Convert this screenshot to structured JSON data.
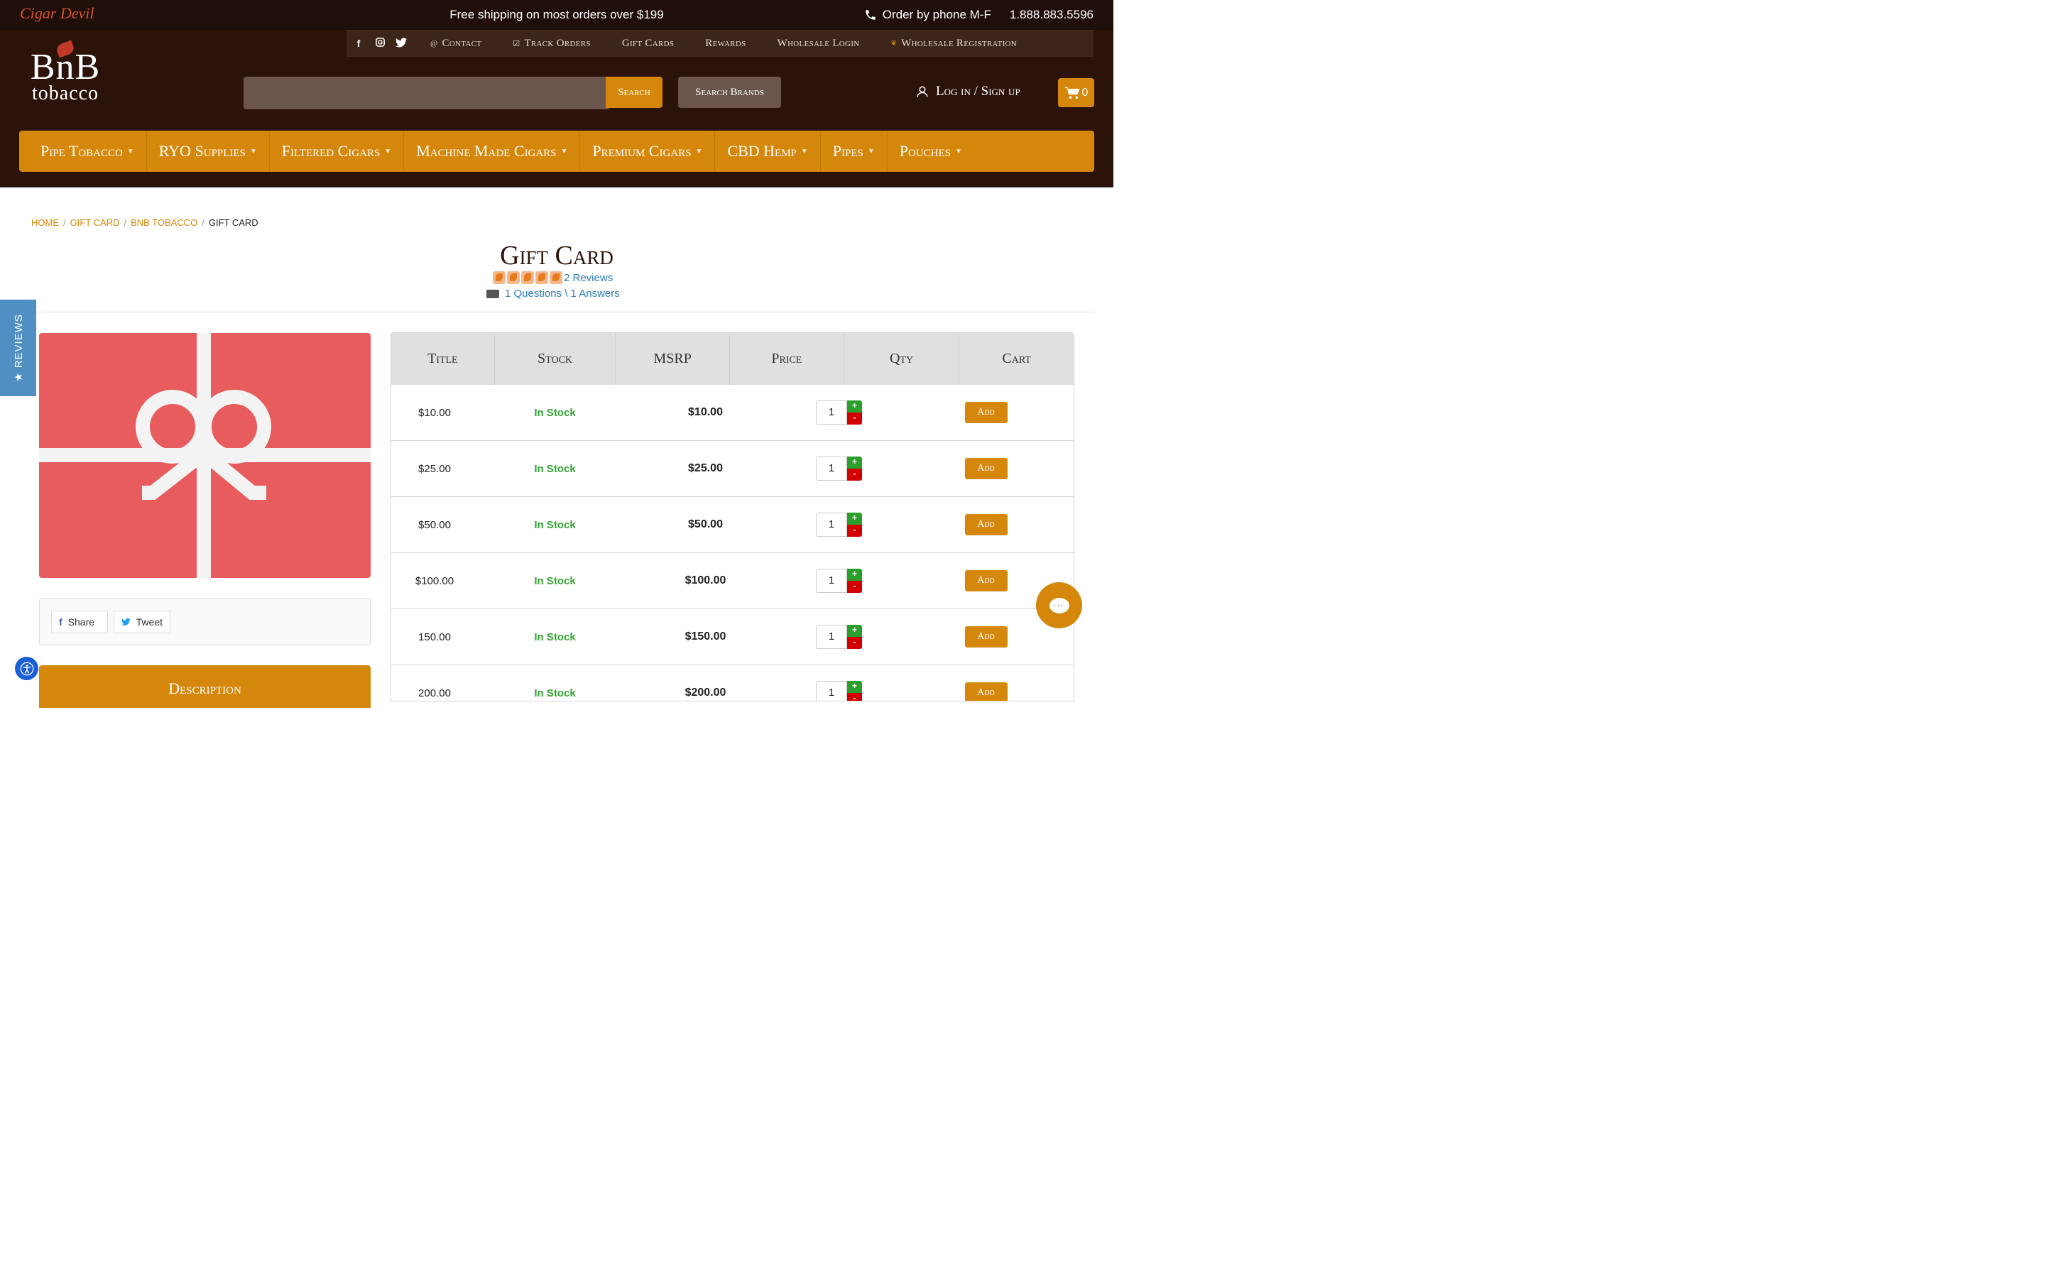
{
  "topbar": {
    "brand": "Cigar Devil",
    "shipping": "Free shipping on most orders over $199",
    "phone_label": "Order by phone M-F",
    "phone_number": "1.888.883.5596"
  },
  "utility_links": [
    "Contact",
    "Track Orders",
    "Gift Cards",
    "Rewards",
    "Wholesale Login",
    "Wholesale Registration"
  ],
  "logo": {
    "line1": "BnB",
    "line2": "tobacco"
  },
  "search": {
    "button": "Search",
    "brands_button": "Search Brands",
    "placeholder": ""
  },
  "account": {
    "login": "Log in / Sign up",
    "cart_count": "0"
  },
  "nav": [
    "Pipe Tobacco",
    "RYO Supplies",
    "Filtered Cigars",
    "Machine Made Cigars",
    "Premium Cigars",
    "CBD Hemp",
    "Pipes",
    "Pouches"
  ],
  "breadcrumb": [
    "HOME",
    "GIFT CARD",
    "BNB TOBACCO",
    "GIFT CARD"
  ],
  "product": {
    "title": "Gift Card",
    "reviews": "2 Reviews",
    "questions": "1 Questions \\ 1 Answers",
    "rating": 5
  },
  "reviews_tab": "★ REVIEWS",
  "share": {
    "share_label": "Share",
    "tweet_label": "Tweet"
  },
  "description_label": "Description",
  "table": {
    "headers": [
      "Title",
      "Stock",
      "MSRP",
      "Price",
      "Qty",
      "Cart"
    ],
    "rows": [
      {
        "title": "$10.00",
        "stock": "In Stock",
        "price": "$10.00",
        "qty": "1",
        "cart": "Add"
      },
      {
        "title": "$25.00",
        "stock": "In Stock",
        "price": "$25.00",
        "qty": "1",
        "cart": "Add"
      },
      {
        "title": "$50.00",
        "stock": "In Stock",
        "price": "$50.00",
        "qty": "1",
        "cart": "Add"
      },
      {
        "title": "$100.00",
        "stock": "In Stock",
        "price": "$100.00",
        "qty": "1",
        "cart": "Add"
      },
      {
        "title": "150.00",
        "stock": "In Stock",
        "price": "$150.00",
        "qty": "1",
        "cart": "Add"
      },
      {
        "title": "200.00",
        "stock": "In Stock",
        "price": "$200.00",
        "qty": "1",
        "cart": "Add"
      }
    ]
  },
  "colors": {
    "accent": "#d4870a",
    "header": "#2c130a",
    "stock": "#33a332"
  },
  "icons": [
    "facebook-icon",
    "instagram-icon",
    "twitter-icon",
    "phone-icon",
    "user-icon",
    "cart-icon",
    "chat-icon",
    "accessibility-icon"
  ]
}
